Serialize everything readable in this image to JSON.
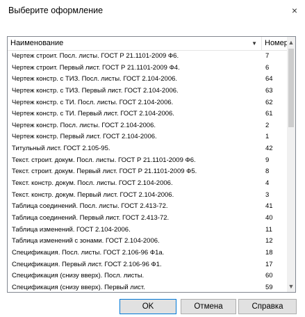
{
  "window": {
    "title": "Выберите оформление"
  },
  "table": {
    "col_name": "Наименование",
    "col_num": "Номер",
    "rows": [
      {
        "name": "Чертеж строит. Посл. листы.  ГОСТ Р 21.1101-2009 Ф6.",
        "num": "7"
      },
      {
        "name": "Чертеж строит. Первый лист. ГОСТ Р 21.1101-2009 Ф4.",
        "num": "6"
      },
      {
        "name": "Чертеж констр. с ТИЗ. Посл. листы. ГОСТ 2.104-2006.",
        "num": "64"
      },
      {
        "name": "Чертеж констр. с ТИЗ. Первый лист. ГОСТ 2.104-2006.",
        "num": "63"
      },
      {
        "name": "Чертеж констр. с ТИ. Посл. листы. ГОСТ 2.104-2006.",
        "num": "62"
      },
      {
        "name": "Чертеж констр. с ТИ. Первый лист. ГОСТ 2.104-2006.",
        "num": "61"
      },
      {
        "name": "Чертеж констр. Посл. листы. ГОСТ 2.104-2006.",
        "num": "2"
      },
      {
        "name": "Чертеж констр. Первый лист. ГОСТ 2.104-2006.",
        "num": "1"
      },
      {
        "name": "Титульный лист. ГОСТ 2.105-95.",
        "num": "42"
      },
      {
        "name": "Текст. строит. докум. Посл. листы. ГОСТ Р 21.1101-2009 Ф6.",
        "num": "9"
      },
      {
        "name": "Текст. строит. докум. Первый лист. ГОСТ Р 21.1101-2009 Ф5.",
        "num": "8"
      },
      {
        "name": "Текст. констр. докум. Посл. листы. ГОСТ 2.104-2006.",
        "num": "4"
      },
      {
        "name": "Текст. констр. докум. Первый лист. ГОСТ 2.104-2006.",
        "num": "3"
      },
      {
        "name": "Таблица соединений. Посл. листы. ГОСТ 2.413-72.",
        "num": "41"
      },
      {
        "name": "Таблица соединений. Первый лист. ГОСТ 2.413-72.",
        "num": "40"
      },
      {
        "name": "Таблица изменений. ГОСТ 2.104-2006.",
        "num": "11"
      },
      {
        "name": "Таблица изменений с зонами. ГОСТ 2.104-2006.",
        "num": "12"
      },
      {
        "name": "Спецификация. Посл. листы. ГОСТ 2.106-96 Ф1а.",
        "num": "18"
      },
      {
        "name": "Спецификация. Первый лист. ГОСТ 2.106-96 Ф1.",
        "num": "17"
      },
      {
        "name": "Спецификация (снизу вверх). Посл. листы.",
        "num": "60"
      },
      {
        "name": "Спецификация (снизу вверх). Первый лист.",
        "num": "59"
      }
    ]
  },
  "buttons": {
    "ok": "OK",
    "cancel": "Отмена",
    "help": "Справка"
  },
  "icons": {
    "close": "×",
    "sort": "▼",
    "scroll_up": "▲",
    "scroll_down": "▼"
  }
}
